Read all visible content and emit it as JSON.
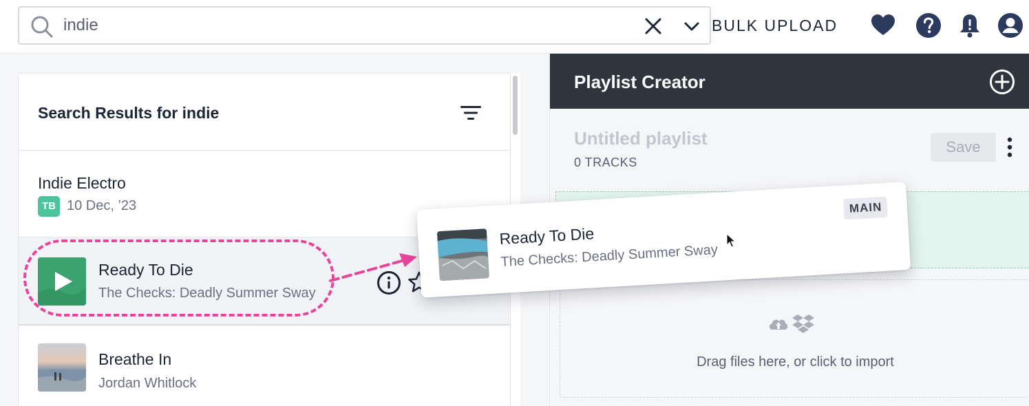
{
  "search": {
    "value": "indie",
    "bulk_upload_label": "BULK UPLOAD"
  },
  "results": {
    "title": "Search Results for indie",
    "items": [
      {
        "title": "Indie Electro",
        "badge": "TB",
        "subtitle": "10 Dec, ’23"
      },
      {
        "title": "Ready To Die",
        "subtitle": "The Checks: Deadly Summer Sway"
      },
      {
        "title": "Breathe In",
        "subtitle": "Jordan Whitlock"
      }
    ]
  },
  "playlist_creator": {
    "header": "Playlist Creator",
    "playlist_name": "Untitled playlist",
    "track_count": "0 TRACKS",
    "save_label": "Save",
    "import_text": "Drag files here, or click to import"
  },
  "drag_card": {
    "title": "Ready To Die",
    "subtitle": "The Checks: Deadly Summer Sway",
    "badge": "MAIN"
  },
  "colors": {
    "accent_pink": "#e8449c",
    "dark_header": "#30343c",
    "badge_green": "#4cc49a",
    "drop_green": "#e4f4ee",
    "icon_navy": "#2c3a5e"
  },
  "icons": [
    "search-icon",
    "clear-icon",
    "chevron-down-icon",
    "heart-icon",
    "help-icon",
    "bell-icon",
    "user-icon",
    "filter-icon",
    "play-icon",
    "info-icon",
    "star-icon",
    "add-circle-icon",
    "kebab-icon",
    "cloud-upload-icon",
    "dropbox-icon",
    "cursor-icon"
  ]
}
